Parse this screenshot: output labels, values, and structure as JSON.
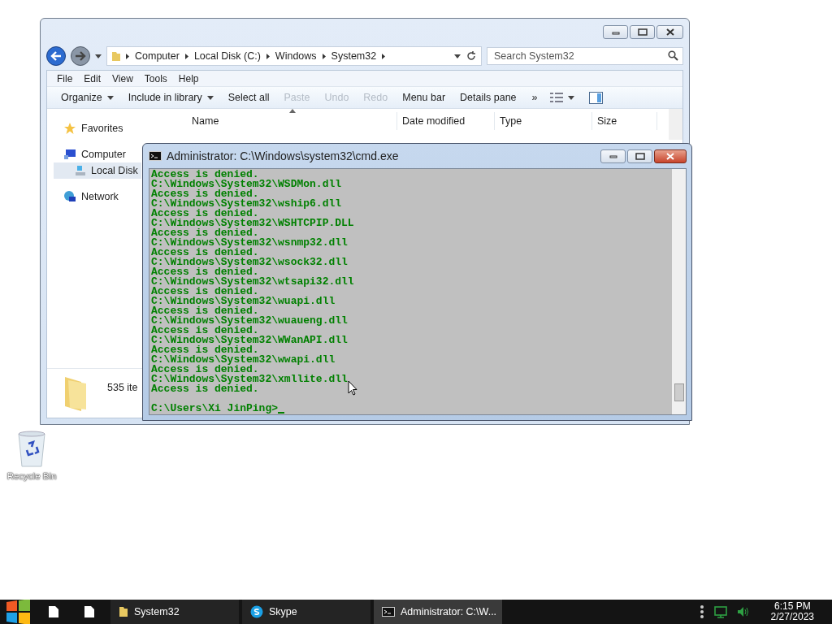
{
  "explorer": {
    "breadcrumb": [
      "Computer",
      "Local Disk (C:)",
      "Windows",
      "System32"
    ],
    "search": {
      "placeholder": "Search System32"
    },
    "menu": [
      "File",
      "Edit",
      "View",
      "Tools",
      "Help"
    ],
    "toolbar": [
      {
        "label": "Organize",
        "dropdown": true,
        "disabled": false
      },
      {
        "label": "Include in library",
        "dropdown": true,
        "disabled": false
      },
      {
        "label": "Select all",
        "dropdown": false,
        "disabled": false
      },
      {
        "label": "Paste",
        "dropdown": false,
        "disabled": true
      },
      {
        "label": "Undo",
        "dropdown": false,
        "disabled": true
      },
      {
        "label": "Redo",
        "dropdown": false,
        "disabled": true
      },
      {
        "label": "Menu bar",
        "dropdown": false,
        "disabled": false
      },
      {
        "label": "Details pane",
        "dropdown": false,
        "disabled": false
      }
    ],
    "overflow": "»",
    "columns": [
      "Name",
      "Date modified",
      "Type",
      "Size"
    ],
    "sidebar": [
      {
        "label": "Favorites",
        "kind": "favorites",
        "selected": false
      },
      {
        "label": "Computer",
        "kind": "computer",
        "selected": false,
        "children": [
          {
            "label": "Local Disk",
            "kind": "disk",
            "selected": true
          }
        ]
      },
      {
        "label": "Network",
        "kind": "network",
        "selected": false
      }
    ],
    "status": "535 ite"
  },
  "cmd": {
    "title": "Administrator: C:\\Windows\\system32\\cmd.exe",
    "lines": [
      "Access is denied.",
      "C:\\Windows\\System32\\WSDMon.dll",
      "Access is denied.",
      "C:\\Windows\\System32\\wship6.dll",
      "Access is denied.",
      "C:\\Windows\\System32\\WSHTCPIP.DLL",
      "Access is denied.",
      "C:\\Windows\\System32\\wsnmp32.dll",
      "Access is denied.",
      "C:\\Windows\\System32\\wsock32.dll",
      "Access is denied.",
      "C:\\Windows\\System32\\wtsapi32.dll",
      "Access is denied.",
      "C:\\Windows\\System32\\wuapi.dll",
      "Access is denied.",
      "C:\\Windows\\System32\\wuaueng.dll",
      "Access is denied.",
      "C:\\Windows\\System32\\WWanAPI.dll",
      "Access is denied.",
      "C:\\Windows\\System32\\wwapi.dll",
      "Access is denied.",
      "C:\\Windows\\System32\\xmllite.dll",
      "Access is denied."
    ],
    "prompt": "C:\\Users\\Xi JinPing>"
  },
  "desktop_icons": [
    {
      "label": "Recycle Bin"
    }
  ],
  "taskbar": {
    "items": [
      {
        "label": "System32",
        "kind": "folder",
        "selected": false
      },
      {
        "label": "Skype",
        "kind": "skype",
        "selected": false
      },
      {
        "label": "Administrator: C:\\W...",
        "kind": "console",
        "selected": true
      }
    ],
    "time": "6:15 PM",
    "date": "2/27/2023"
  }
}
